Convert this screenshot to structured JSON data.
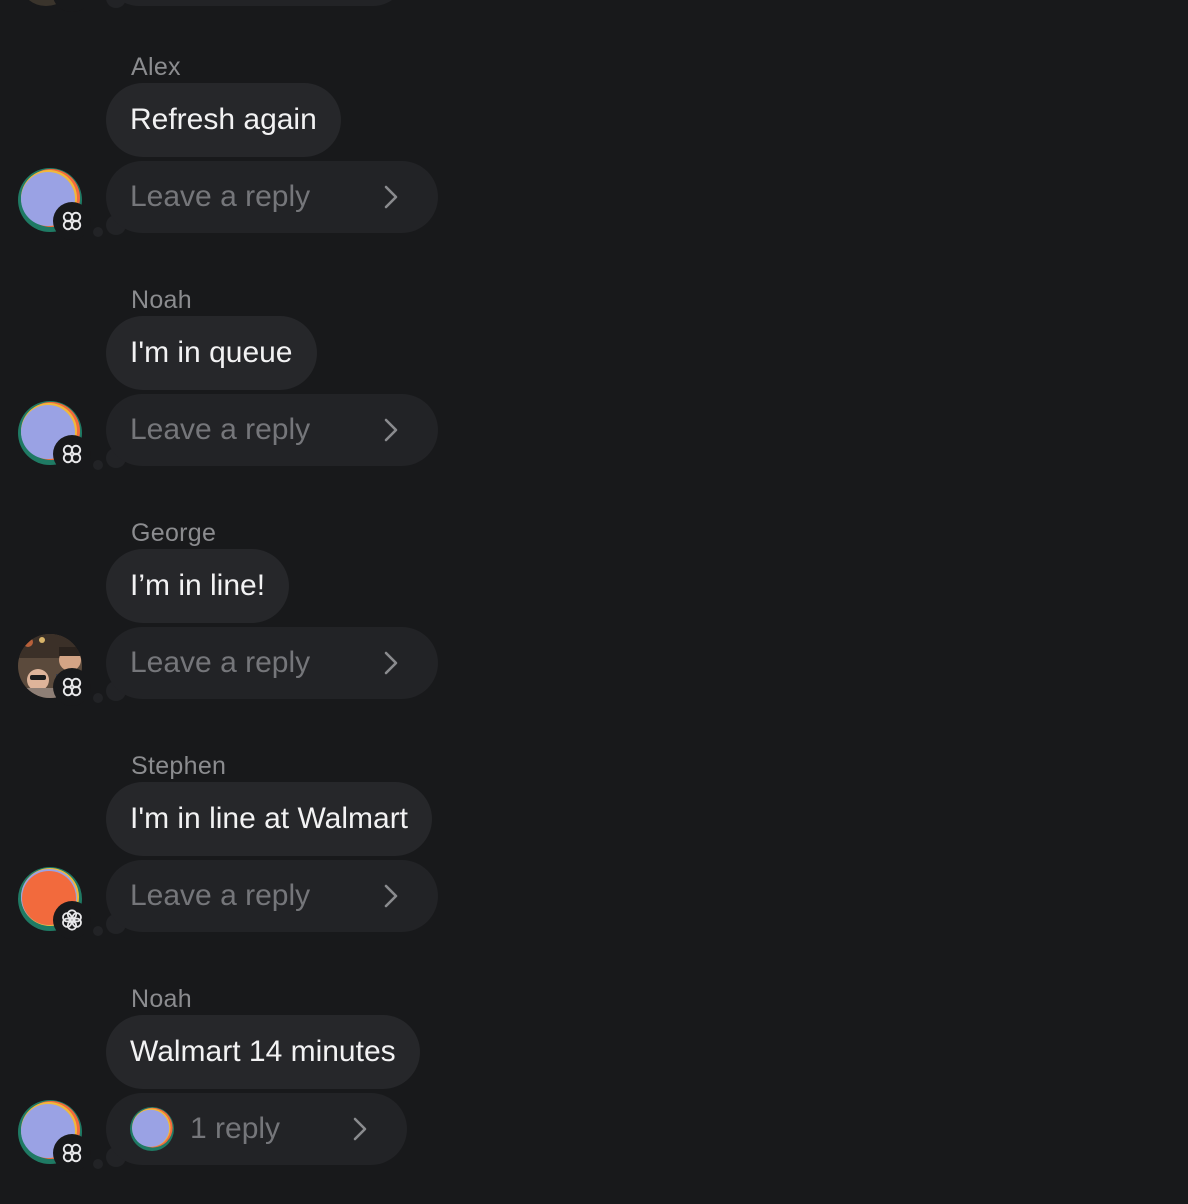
{
  "messages": [
    {
      "sender": "Alex",
      "text": "Refresh again",
      "reply_label": "Leave a reply",
      "avatar_icon": "gradient-avatar-lavender",
      "badge_icon": "clover-badge-icon"
    },
    {
      "sender": "Noah",
      "text": "I'm in queue",
      "reply_label": "Leave a reply",
      "avatar_icon": "gradient-avatar-lavender",
      "badge_icon": "clover-badge-icon"
    },
    {
      "sender": "George",
      "text": "I’m in line!",
      "reply_label": "Leave a reply",
      "avatar_icon": "photo-avatar",
      "badge_icon": "clover-badge-icon"
    },
    {
      "sender": "Stephen",
      "text": "I'm in line at Walmart",
      "reply_label": "Leave a reply",
      "avatar_icon": "gradient-avatar-orange",
      "badge_icon": "flower-badge-icon"
    },
    {
      "sender": "Noah",
      "text": "Walmart 14 minutes",
      "reply_label": "1 reply",
      "avatar_icon": "gradient-avatar-lavender",
      "badge_icon": "clover-badge-icon",
      "reply_avatar_icon": "gradient-avatar-lavender"
    }
  ],
  "colors": {
    "background": "#18191b",
    "bubble": "#26272a",
    "reply_bubble": "#222326",
    "name_text": "#8b8c8f",
    "message_text": "#f2f2f3",
    "reply_text": "#75767a",
    "avatar_lavender": "#9aa2e4",
    "avatar_orange": "#f26a3d",
    "avatar_teal": "#1f7a64",
    "avatar_yellow": "#f0b93c"
  }
}
